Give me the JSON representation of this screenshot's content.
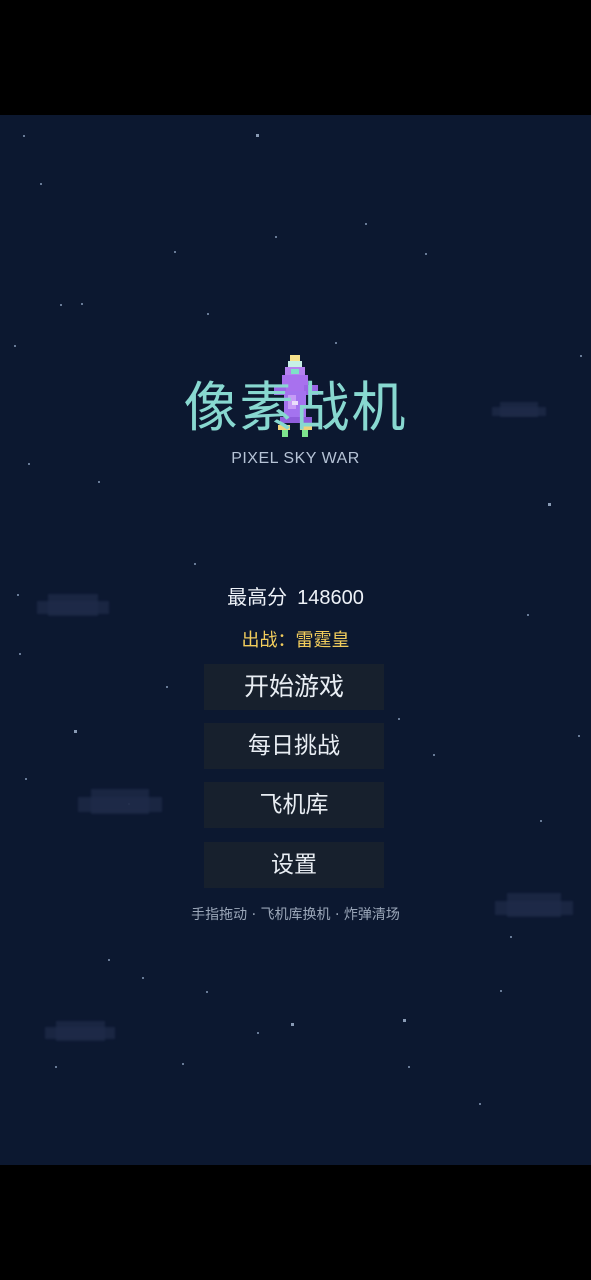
{
  "title": {
    "main": "像素战机",
    "subtitle": "PIXEL SKY WAR"
  },
  "high_score": {
    "label": "最高分",
    "value": "148600"
  },
  "current_ship": {
    "label": "出战：",
    "name": "雷霆皇"
  },
  "menu": {
    "start": "开始游戏",
    "daily": "每日挑战",
    "hangar": "飞机库",
    "settings": "设置"
  },
  "hint": "手指拖动 · 飞机库换机 · 炸弹清场",
  "colors": {
    "background": "#0c1830",
    "title": "#88d8d0",
    "ship_name": "#f2cd5c",
    "button": "#17202d"
  }
}
